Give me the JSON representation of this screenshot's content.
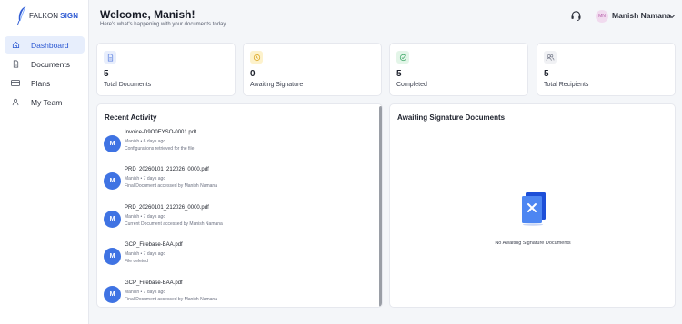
{
  "brand": {
    "name_part1": "FALKON",
    "name_part2": "SIGN",
    "accent": "#2f5bd3"
  },
  "sidebar": {
    "items": [
      {
        "label": "Dashboard",
        "icon": "home-icon",
        "active": true
      },
      {
        "label": "Documents",
        "icon": "document-icon",
        "active": false
      },
      {
        "label": "Plans",
        "icon": "credit-card-icon",
        "active": false
      },
      {
        "label": "My Team",
        "icon": "user-icon",
        "active": false
      }
    ]
  },
  "header": {
    "title": "Welcome, Manish!",
    "subtitle": "Here's what's happening with your documents today",
    "user": {
      "initials": "MN",
      "name": "Manish Namana"
    }
  },
  "stats": [
    {
      "value": "5",
      "label": "Total Documents",
      "icon": "document-icon",
      "color": "#e8eefc"
    },
    {
      "value": "0",
      "label": "Awaiting Signature",
      "icon": "clock-icon",
      "color": "#fdf2cc"
    },
    {
      "value": "5",
      "label": "Completed",
      "icon": "check-circle-icon",
      "color": "#e3f5e8"
    },
    {
      "value": "5",
      "label": "Total Recipients",
      "icon": "users-icon",
      "color": "#f0f1f4"
    }
  ],
  "recent_activity": {
    "title": "Recent Activity",
    "items": [
      {
        "avatar": "M",
        "file": "Invoice-D9O0EYSO-0001.pdf",
        "meta": "Manish • 6 days ago",
        "desc": "Configurations retrieved for the file"
      },
      {
        "avatar": "M",
        "file": "PRD_20260101_212026_0000.pdf",
        "meta": "Manish • 7 days ago",
        "desc": "Final Document accessed by Manish Namana"
      },
      {
        "avatar": "M",
        "file": "PRD_20260101_212026_0000.pdf",
        "meta": "Manish • 7 days ago",
        "desc": "Current Document accessed by Manish Namana"
      },
      {
        "avatar": "M",
        "file": "GCP_Firebase-BAA.pdf",
        "meta": "Manish • 7 days ago",
        "desc": "File deleted"
      },
      {
        "avatar": "M",
        "file": "GCP_Firebase-BAA.pdf",
        "meta": "Manish • 7 days ago",
        "desc": "Final Document accessed by Manish Namana"
      }
    ]
  },
  "awaiting": {
    "title": "Awaiting Signature Documents",
    "empty_text": "No Awaiting Signature Documents",
    "icon": "empty-document-icon"
  }
}
